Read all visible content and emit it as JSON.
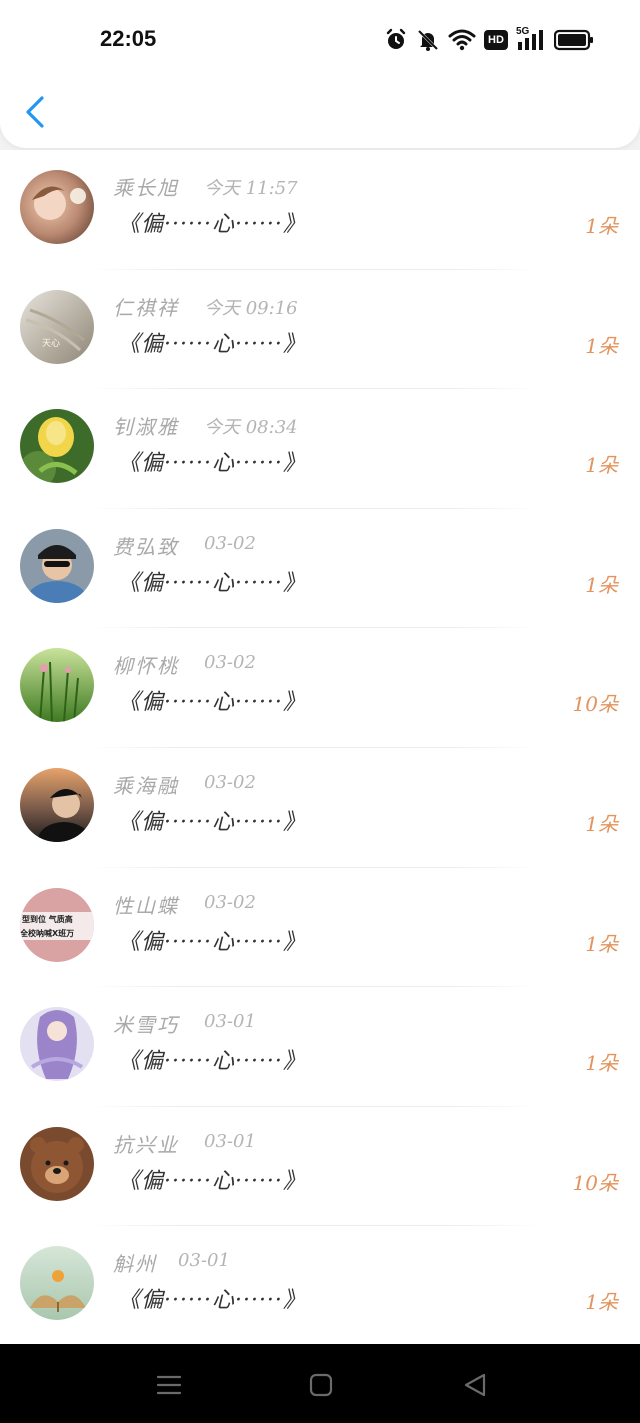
{
  "status_bar": {
    "time": "22:05",
    "icons": [
      "alarm-icon",
      "mute-bell-icon",
      "wifi-icon",
      "hd-icon",
      "5g-signal-icon",
      "battery-icon"
    ],
    "hd_label": "HD",
    "network_label": "5G"
  },
  "header": {
    "back_icon": "chevron-left-icon",
    "accent": "#2196f3"
  },
  "colors": {
    "name": "#a9a9a9",
    "time": "#b4b4b4",
    "message": "#333333",
    "count": "#e3935b"
  },
  "messages": [
    {
      "name": "乘长旭",
      "time": "今天 11:57",
      "message": "《偏······心······》",
      "count": "1朵"
    },
    {
      "name": "仁祺祥",
      "time": "今天 09:16",
      "message": "《偏······心······》",
      "count": "1朵"
    },
    {
      "name": "钊淑雅",
      "time": "今天 08:34",
      "message": "《偏······心······》",
      "count": "1朵"
    },
    {
      "name": "费弘致",
      "time": "03-02",
      "message": "《偏······心······》",
      "count": "1朵"
    },
    {
      "name": "柳怀桃",
      "time": "03-02",
      "message": "《偏······心······》",
      "count": "10朵"
    },
    {
      "name": "乘海融",
      "time": "03-02",
      "message": "《偏······心······》",
      "count": "1朵"
    },
    {
      "name": "性山蝶",
      "time": "03-02",
      "message": "《偏······心······》",
      "count": "1朵"
    },
    {
      "name": "米雪巧",
      "time": "03-01",
      "message": "《偏······心······》",
      "count": "1朵"
    },
    {
      "name": "抗兴业",
      "time": "03-01",
      "message": "《偏······心······》",
      "count": "10朵"
    },
    {
      "name": "斛州",
      "time": "03-01",
      "message": "《偏······心······》",
      "count": "1朵"
    }
  ],
  "avatars": {
    "avatar_1_text": "",
    "avatar_2_text": "天心",
    "avatar_7_line1": "型到位 气质高",
    "avatar_7_line2": "全校呐喊X班万"
  },
  "nav_bar": [
    "menu-icon",
    "home-square-icon",
    "back-triangle-icon"
  ]
}
